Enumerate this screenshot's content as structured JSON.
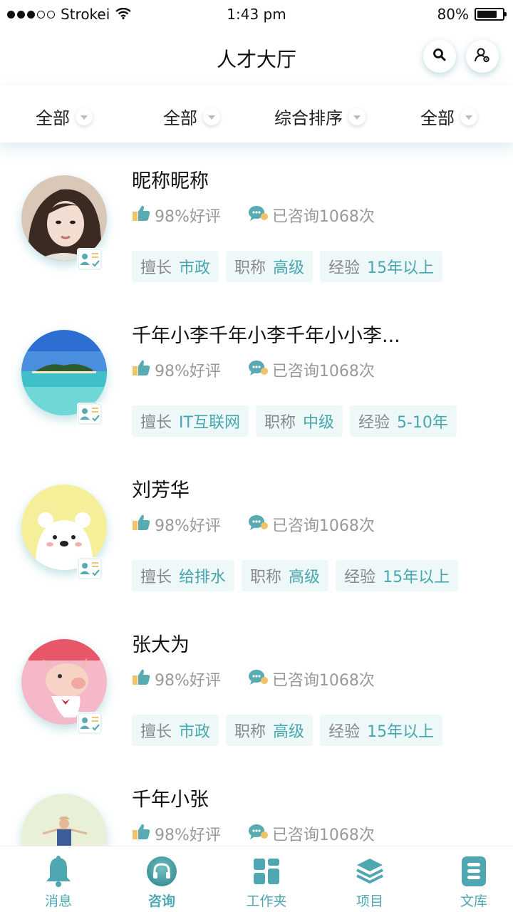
{
  "status": {
    "carrier": "Strokei",
    "time": "1:43 pm",
    "battery": "80%",
    "battery_level": 0.8
  },
  "nav": {
    "title": "人才大厅"
  },
  "filters": [
    {
      "label": "全部"
    },
    {
      "label": "全部"
    },
    {
      "label": "综合排序"
    },
    {
      "label": "全部"
    }
  ],
  "talents": [
    {
      "name": "昵称昵称",
      "rating": "98%好评",
      "consults": "已咨询1068次",
      "tags": [
        {
          "k": "擅长",
          "v": "市政"
        },
        {
          "k": "职称",
          "v": "高级"
        },
        {
          "k": "经验",
          "v": "15年以上"
        }
      ],
      "avatar": "portrait"
    },
    {
      "name": "千年小李千年小李千年小小李...",
      "rating": "98%好评",
      "consults": "已咨询1068次",
      "tags": [
        {
          "k": "擅长",
          "v": "IT互联网"
        },
        {
          "k": "职称",
          "v": "中级"
        },
        {
          "k": "经验",
          "v": "5-10年"
        }
      ],
      "avatar": "beach"
    },
    {
      "name": "刘芳华",
      "rating": "98%好评",
      "consults": "已咨询1068次",
      "tags": [
        {
          "k": "擅长",
          "v": "给排水"
        },
        {
          "k": "职称",
          "v": "高级"
        },
        {
          "k": "经验",
          "v": "15年以上"
        }
      ],
      "avatar": "bear"
    },
    {
      "name": "张大为",
      "rating": "98%好评",
      "consults": "已咨询1068次",
      "tags": [
        {
          "k": "擅长",
          "v": "市政"
        },
        {
          "k": "职称",
          "v": "高级"
        },
        {
          "k": "经验",
          "v": "15年以上"
        }
      ],
      "avatar": "pig"
    },
    {
      "name": "千年小张",
      "rating": "98%好评",
      "consults": "已咨询1068次",
      "tags": [],
      "avatar": "person"
    }
  ],
  "tabs": [
    {
      "label": "消息",
      "icon": "bell-icon"
    },
    {
      "label": "咨询",
      "icon": "headphones-icon",
      "active": true
    },
    {
      "label": "工作夹",
      "icon": "grid-icon"
    },
    {
      "label": "项目",
      "icon": "layers-icon"
    },
    {
      "label": "文库",
      "icon": "library-icon"
    }
  ],
  "colors": {
    "accent": "#4fa7b2",
    "tag_bg": "#eef8f9",
    "thumb": "#f0c26a"
  }
}
